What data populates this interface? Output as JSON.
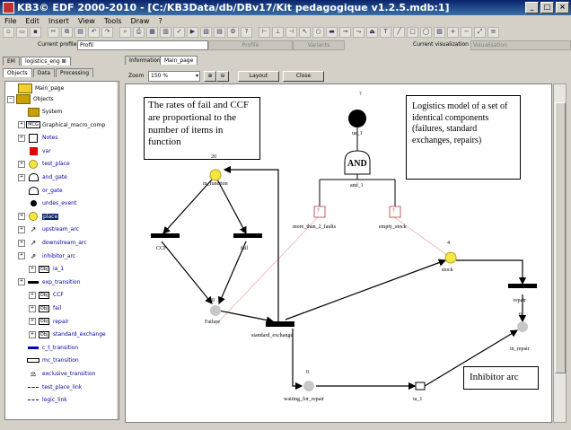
{
  "window": {
    "title": "KB3© EDF 2000-2010 - [C:/KB3Data/db/DBv17/Kit pedagogique v1.2.5.mdb:1]"
  },
  "menu": [
    "File",
    "Edit",
    "Insert",
    "View",
    "Tools",
    "Draw",
    "?"
  ],
  "profile": {
    "current_profile_label": "Current profile",
    "current_profile_value": "Profil",
    "profile_button": "Profile",
    "variants_button": "Variants",
    "current_visualization_label": "Current visualization",
    "current_visualization_value": "Visualisation"
  },
  "left_tabs": [
    "EM",
    "logistics_eng"
  ],
  "sub_tabs": [
    "Objects",
    "Data",
    "Processing"
  ],
  "tree": {
    "root": "Main_page",
    "objects": "Objects",
    "items": [
      "System",
      "Graphical_macro_comp",
      "Notes",
      "var",
      "test_place",
      "and_gate",
      "or_gate",
      "undes_event",
      "place",
      "upstream_arc",
      "downstream_arc",
      "inhibitor_arc",
      "ia_1",
      "exp_transition",
      "CCF",
      "fail",
      "repair",
      "standard_exchange",
      "c_t_transition",
      "mc_transition",
      "exclusive_transition",
      "test_place_link",
      "logic_link"
    ]
  },
  "right_tabs": [
    "Information",
    "Main_page"
  ],
  "zoom": {
    "label": "Zoom",
    "value": "150 %",
    "layout_button": "Layout",
    "close_button": "Close"
  },
  "diagram": {
    "note_rates": "The rates of fail and CCF are proportional to the number of items in function",
    "note_model": "Logistics model of a set of identical components (failures, standard exchanges, repairs)",
    "note_inhibitor": "Inhibitor arc",
    "ue_label": "ue_1",
    "and_text": "AND",
    "and_label": "and_1",
    "in_function_label": "in_function",
    "in_function_tokens": "20",
    "failure_label": "Failure",
    "failure_tokens": "0",
    "ccf_label": "CCF",
    "fail_label": "fail",
    "test1_label": "more_than_2_faults",
    "test2_label": "empty_stock",
    "stock_label": "stock",
    "stock_tokens": "4",
    "std_label": "standard_exchange",
    "repair_label": "repair",
    "in_repair_label": "in_repair",
    "in_repair_tokens": "0",
    "waiting_label": "waiting_for_repair",
    "waiting_tokens": "0",
    "ia_label": "ia_1",
    "q_mark": "?"
  },
  "colors": {
    "title_bar": "#0a246a",
    "token_yellow": "#f5e642",
    "selection": "#0a246a"
  }
}
